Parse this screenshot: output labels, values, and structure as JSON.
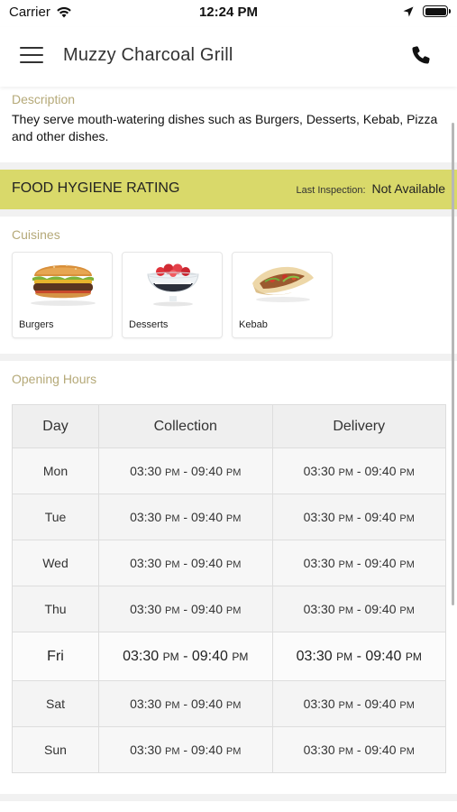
{
  "status_bar": {
    "carrier": "Carrier",
    "time": "12:24 PM"
  },
  "header": {
    "title": "Muzzy Charcoal Grill"
  },
  "description": {
    "label": "Description",
    "text": "They serve mouth-watering dishes such as Burgers, Desserts, Kebab, Pizza and other dishes."
  },
  "hygiene": {
    "title": "FOOD HYGIENE RATING",
    "inspection_label": "Last Inspection:",
    "inspection_value": "Not Available",
    "color": "#d9d96a"
  },
  "cuisines": {
    "label": "Cuisines",
    "items": [
      {
        "name": "Burgers",
        "icon": "burger-image"
      },
      {
        "name": "Desserts",
        "icon": "dessert-image"
      },
      {
        "name": "Kebab",
        "icon": "kebab-image"
      }
    ]
  },
  "opening_hours": {
    "label": "Opening Hours",
    "columns": [
      "Day",
      "Collection",
      "Delivery"
    ],
    "time_from": "03:30",
    "time_to": "09:40",
    "suffix": "PM",
    "separator": "-",
    "rows": [
      {
        "day": "Mon"
      },
      {
        "day": "Tue"
      },
      {
        "day": "Wed"
      },
      {
        "day": "Thu"
      },
      {
        "day": "Fri",
        "today": true
      },
      {
        "day": "Sat"
      },
      {
        "day": "Sun"
      }
    ]
  },
  "colors": {
    "accent_label": "#b5a978"
  }
}
